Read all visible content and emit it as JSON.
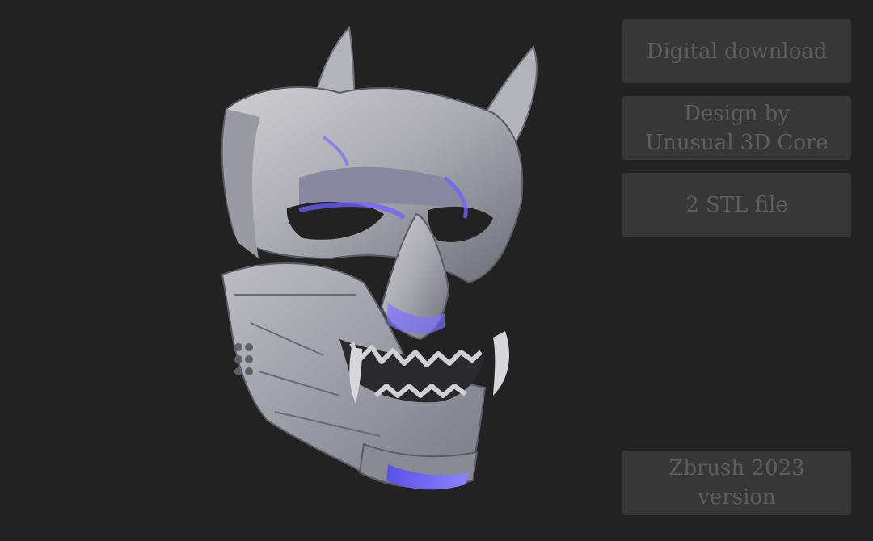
{
  "product_image": {
    "subject": "oni-mask-render",
    "colors": {
      "background": "#222222",
      "surface": "#a8a8ae",
      "highlight": "#d8d8dc",
      "shadow": "#3a3a44",
      "rim_light": "#6e62ff"
    }
  },
  "info_boxes": [
    {
      "lines": [
        "Digital download"
      ]
    },
    {
      "lines": [
        "Design by",
        "Unusual 3D Core"
      ]
    },
    {
      "lines": [
        "2 STL file"
      ]
    },
    {
      "lines": [
        "Zbrush 2023",
        "version"
      ]
    }
  ]
}
